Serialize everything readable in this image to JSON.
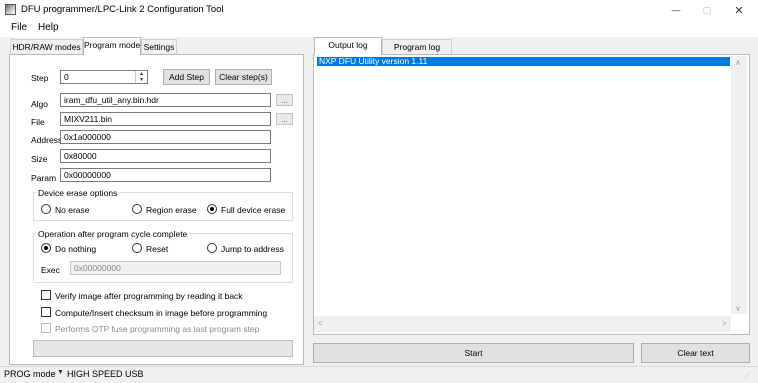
{
  "window": {
    "title": "DFU programmer/LPC-Link 2 Configuration Tool",
    "controls": {
      "minimize": "—",
      "maximize": "▢",
      "close": "✕"
    }
  },
  "menu": {
    "file": "File",
    "help": "Help"
  },
  "tabs": {
    "left": [
      "HDR/RAW modes",
      "Program mode",
      "Settings"
    ],
    "active_left": "Program mode",
    "right": [
      "Output log",
      "Program log"
    ],
    "active_right": "Output log"
  },
  "program": {
    "step_label": "Step",
    "step_value": "0",
    "add_step": "Add Step",
    "clear_steps": "Clear step(s)",
    "algo_label": "Algo",
    "algo_value": "iram_dfu_util_any.bin.hdr",
    "file_label": "File",
    "file_value": "MIXV211.bin",
    "browse": "...",
    "address_label": "Address",
    "address_value": "0x1a000000",
    "size_label": "Size",
    "size_value": "0x80000",
    "param_label": "Param",
    "param_value": "0x00000000"
  },
  "erase": {
    "title": "Device erase options",
    "options": [
      "No erase",
      "Region erase",
      "Full device erase"
    ],
    "selected": "Full device erase"
  },
  "after": {
    "title": "Operation after program cycle complete",
    "options": [
      "Do nothing",
      "Reset",
      "Jump to address"
    ],
    "selected": "Do nothing",
    "exec_label": "Exec",
    "exec_value": "0x00000000"
  },
  "checks": {
    "verify": "Verify image after programming by reading it back",
    "checksum": "Compute/Insert checksum in image before programming",
    "otp": "Performs OTP fuse programming as last program step"
  },
  "log": {
    "lines": [
      "NXP DFU Utility version 1.11"
    ],
    "start": "Start",
    "clear": "Clear text"
  },
  "status": {
    "mode": "PROG mode",
    "speed": "HIGH SPEED USB"
  }
}
